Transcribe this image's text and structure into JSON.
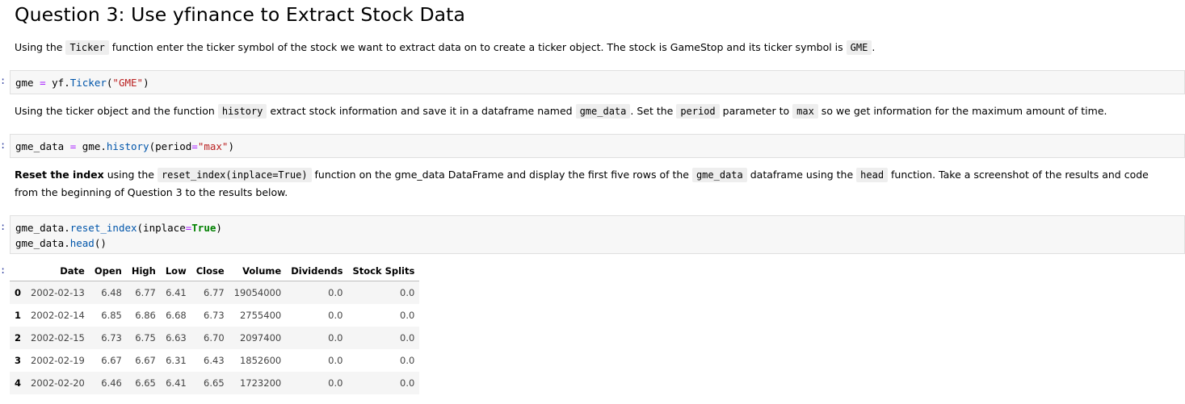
{
  "heading": "Question 3: Use yfinance to Extract Stock Data",
  "para1": {
    "t1": "Using the ",
    "c1": "Ticker",
    "t2": " function enter the ticker symbol of the stock we want to extract data on to create a ticker object. The stock is GameStop and its ticker symbol is ",
    "c2": "GME",
    "t3": "."
  },
  "cell1": {
    "prompt": ":",
    "var": "gme",
    "eq": " = ",
    "obj": "yf.",
    "fn": "Ticker",
    "p1": "(",
    "arg": "\"GME\"",
    "p2": ")"
  },
  "para2": {
    "t1": "Using the ticker object and the function ",
    "c1": "history",
    "t2": " extract stock information and save it in a dataframe named ",
    "c2": "gme_data",
    "t3": ". Set the ",
    "c3": "period",
    "t4": " parameter to ",
    "c4": "max",
    "t5": " so we get information for the maximum amount of time."
  },
  "cell2": {
    "prompt": ":",
    "var": "gme_data",
    "eq": " = ",
    "obj": "gme.",
    "fn": "history",
    "p1": "(period",
    "eq2": "=",
    "arg": "\"max\"",
    "p2": ")"
  },
  "para3": {
    "b1": "Reset the index",
    "t1": " using the ",
    "c1": "reset_index(inplace=True)",
    "t2": " function on the gme_data DataFrame and display the first five rows of the ",
    "c2": "gme_data",
    "t3": " dataframe using the ",
    "c3": "head",
    "t4": " function. Take a screenshot of the results and code from the beginning of Question 3 to the results below."
  },
  "cell3": {
    "prompt": ":",
    "l1_obj": "gme_data.",
    "l1_fn": "reset_index",
    "l1_p1": "(inplace",
    "l1_eq": "=",
    "l1_kw": "True",
    "l1_p2": ")",
    "l2_obj": "gme_data.",
    "l2_fn": "head",
    "l2_p": "()"
  },
  "output_prompt": ":",
  "table": {
    "columns": [
      "",
      "Date",
      "Open",
      "High",
      "Low",
      "Close",
      "Volume",
      "Dividends",
      "Stock Splits"
    ],
    "rows": [
      [
        "0",
        "2002-02-13",
        "6.48",
        "6.77",
        "6.41",
        "6.77",
        "19054000",
        "0.0",
        "0.0"
      ],
      [
        "1",
        "2002-02-14",
        "6.85",
        "6.86",
        "6.68",
        "6.73",
        "2755400",
        "0.0",
        "0.0"
      ],
      [
        "2",
        "2002-02-15",
        "6.73",
        "6.75",
        "6.63",
        "6.70",
        "2097400",
        "0.0",
        "0.0"
      ],
      [
        "3",
        "2002-02-19",
        "6.67",
        "6.67",
        "6.31",
        "6.43",
        "1852600",
        "0.0",
        "0.0"
      ],
      [
        "4",
        "2002-02-20",
        "6.46",
        "6.65",
        "6.41",
        "6.65",
        "1723200",
        "0.0",
        "0.0"
      ]
    ]
  }
}
